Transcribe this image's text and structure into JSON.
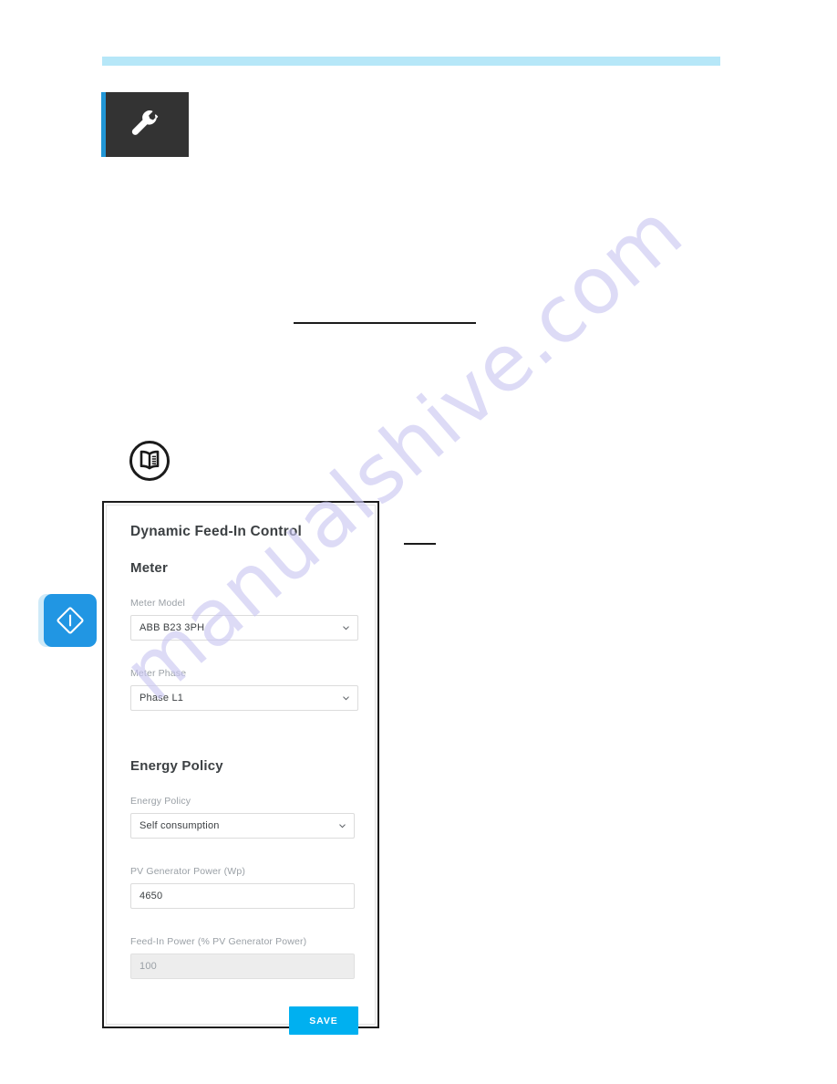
{
  "page": {
    "watermark_text": "manualshive.com",
    "top_rule_color": "#b6e7f8"
  },
  "icons": {
    "wrench_tile": {
      "name": "wrench-icon",
      "tile_background": "#333333",
      "accent_stripe": "#2196d6"
    },
    "book_note": {
      "name": "open-book-icon"
    },
    "notice_badge": {
      "name": "important-notice-icon",
      "color": "#2196e3"
    }
  },
  "panel": {
    "title": "Dynamic Feed-In Control",
    "sections": [
      {
        "heading": "Meter",
        "fields": [
          {
            "label": "Meter Model",
            "type": "select",
            "value": "ABB B23 3PH"
          },
          {
            "label": "Meter Phase",
            "type": "select",
            "value": "Phase L1"
          }
        ]
      },
      {
        "heading": "Energy Policy",
        "fields": [
          {
            "label": "Energy Policy",
            "type": "select",
            "value": "Self consumption"
          },
          {
            "label": "PV Generator Power (Wp)",
            "type": "text",
            "value": "4650"
          },
          {
            "label": "Feed-In Power (% PV Generator Power)",
            "type": "text",
            "value": "100",
            "disabled": true
          }
        ]
      }
    ],
    "save_label": "SAVE",
    "save_color": "#00b0f0"
  }
}
